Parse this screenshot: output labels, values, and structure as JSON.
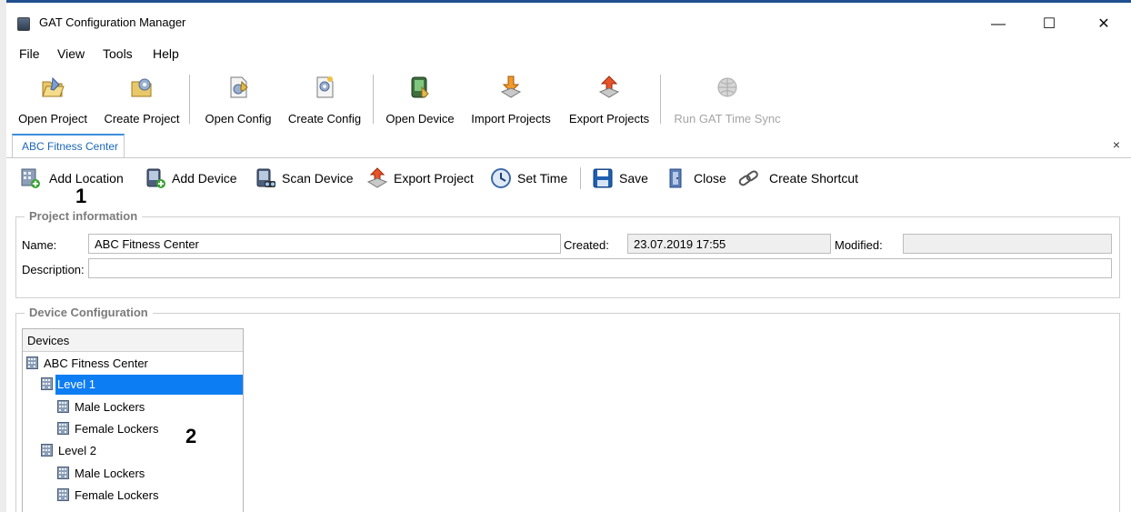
{
  "window": {
    "title": "GAT Configuration Manager",
    "controls": {
      "minimize": "—",
      "maximize": "☐",
      "close": "✕"
    }
  },
  "menu": [
    "File",
    "View",
    "Tools",
    "Help"
  ],
  "toolbar": {
    "open_project": "Open Project",
    "create_project": "Create Project",
    "open_config": "Open Config",
    "create_config": "Create Config",
    "open_device": "Open Device",
    "import_projects": "Import Projects",
    "export_projects": "Export Projects",
    "run_gat_time_sync": "Run GAT Time Sync"
  },
  "tabs": {
    "active_label": "ABC Fitness Center",
    "close_glyph": "×"
  },
  "actions": {
    "add_location": "Add Location",
    "add_device": "Add Device",
    "scan_device": "Scan Device",
    "export_project": "Export Project",
    "set_time": "Set Time",
    "save": "Save",
    "close": "Close",
    "create_shortcut": "Create Shortcut"
  },
  "markers": {
    "one": "1",
    "two": "2"
  },
  "project_info": {
    "title": "Project information",
    "name_label": "Name:",
    "name_value": "ABC Fitness Center",
    "created_label": "Created:",
    "created_value": "23.07.2019 17:55",
    "modified_label": "Modified:",
    "modified_value": "",
    "description_label": "Description:",
    "description_value": ""
  },
  "device_config": {
    "title": "Device Configuration",
    "tree_header": "Devices",
    "nodes": [
      {
        "label": "ABC Fitness Center"
      },
      {
        "label": "Level 1"
      },
      {
        "label": "Male Lockers"
      },
      {
        "label": "Female Lockers"
      },
      {
        "label": "Level 2"
      },
      {
        "label": "Male Lockers"
      },
      {
        "label": "Female Lockers"
      }
    ],
    "selected": "Level 1"
  },
  "colors": {
    "accent": "#0d7df3",
    "tab_text": "#1b67b6",
    "group_title": "#7b7b7b"
  },
  "icons": {
    "open_project": "folder-open-icon",
    "create_project": "folder-gear-icon",
    "open_config": "document-open-icon",
    "create_config": "document-gear-icon",
    "open_device": "device-open-icon",
    "import_projects": "download-arrow-icon",
    "export_projects": "upload-arrow-icon",
    "run_gat_time_sync": "globe-icon"
  }
}
